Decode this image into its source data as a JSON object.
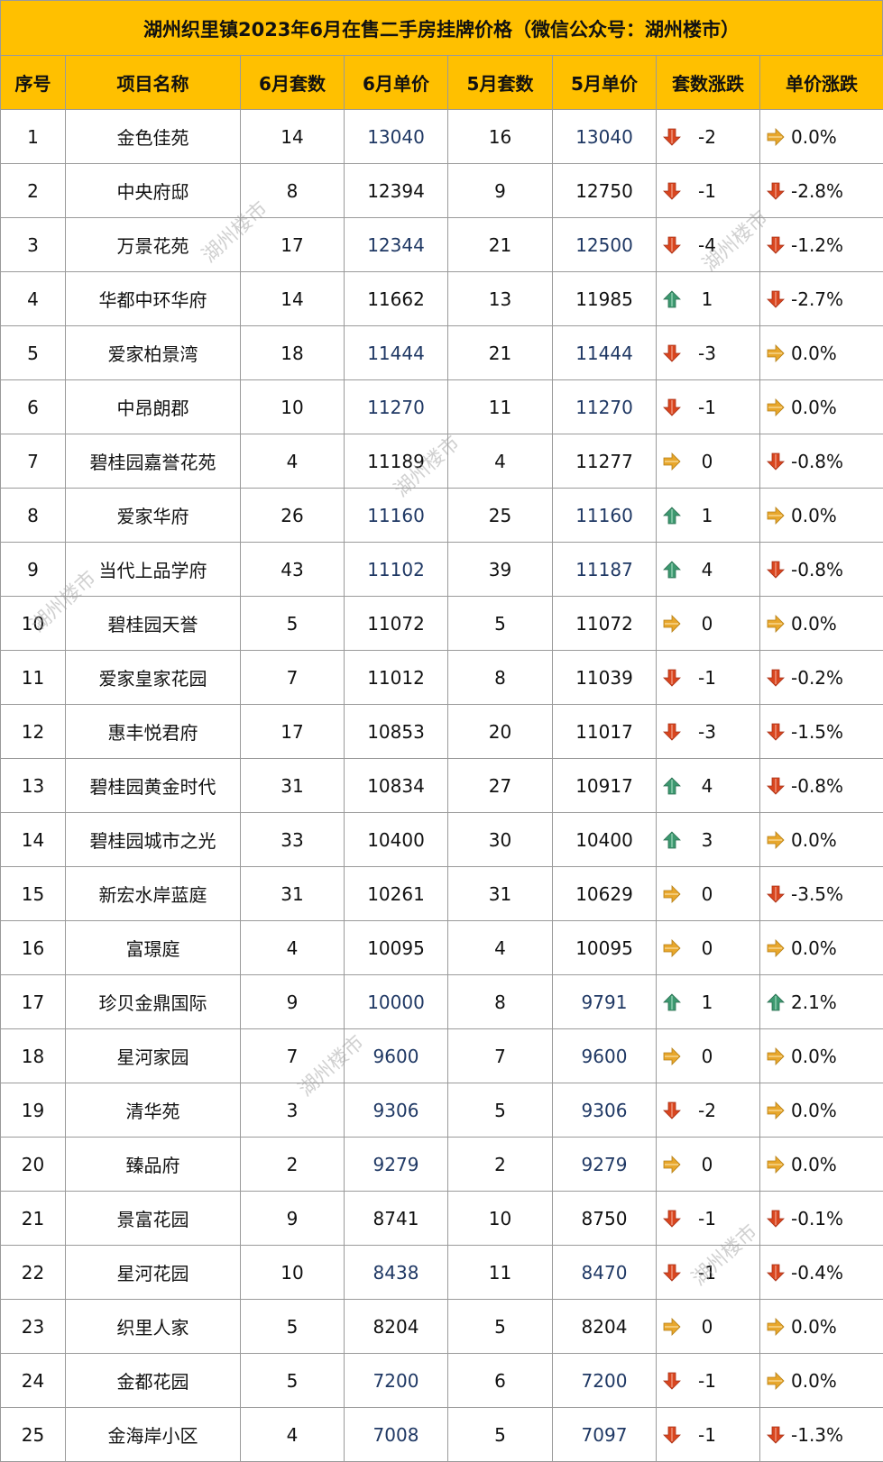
{
  "title": "湖州织里镇2023年6月在售二手房挂牌价格（微信公众号：湖州楼市）",
  "headers": [
    "序号",
    "项目名称",
    "6月套数",
    "6月单价",
    "5月套数",
    "5月单价",
    "套数涨跌",
    "单价涨跌"
  ],
  "watermark": "湖州楼市",
  "colors": {
    "header_bg": "#FFC000",
    "up": "#3d9970",
    "down": "#d9461f",
    "flat": "#e8a72c",
    "blue_price": "#1f3864"
  },
  "rows": [
    {
      "no": "1",
      "name": "金色佳苑",
      "jun_count": "14",
      "jun_price": "13040",
      "may_count": "16",
      "may_price": "13040",
      "count_dir": "down",
      "count_change": "-2",
      "price_dir": "flat",
      "price_change": "0.0%"
    },
    {
      "no": "2",
      "name": "中央府邸",
      "jun_count": "8",
      "jun_price": "12394",
      "may_count": "9",
      "may_price": "12750",
      "count_dir": "down",
      "count_change": "-1",
      "price_dir": "down",
      "price_change": "-2.8%"
    },
    {
      "no": "3",
      "name": "万景花苑",
      "jun_count": "17",
      "jun_price": "12344",
      "may_count": "21",
      "may_price": "12500",
      "count_dir": "down",
      "count_change": "-4",
      "price_dir": "down",
      "price_change": "-1.2%"
    },
    {
      "no": "4",
      "name": "华都中环华府",
      "jun_count": "14",
      "jun_price": "11662",
      "may_count": "13",
      "may_price": "11985",
      "count_dir": "up",
      "count_change": "1",
      "price_dir": "down",
      "price_change": "-2.7%"
    },
    {
      "no": "5",
      "name": "爱家柏景湾",
      "jun_count": "18",
      "jun_price": "11444",
      "may_count": "21",
      "may_price": "11444",
      "count_dir": "down",
      "count_change": "-3",
      "price_dir": "flat",
      "price_change": "0.0%"
    },
    {
      "no": "6",
      "name": "中昂朗郡",
      "jun_count": "10",
      "jun_price": "11270",
      "may_count": "11",
      "may_price": "11270",
      "count_dir": "down",
      "count_change": "-1",
      "price_dir": "flat",
      "price_change": "0.0%"
    },
    {
      "no": "7",
      "name": "碧桂园嘉誉花苑",
      "jun_count": "4",
      "jun_price": "11189",
      "may_count": "4",
      "may_price": "11277",
      "count_dir": "flat",
      "count_change": "0",
      "price_dir": "down",
      "price_change": "-0.8%"
    },
    {
      "no": "8",
      "name": "爱家华府",
      "jun_count": "26",
      "jun_price": "11160",
      "may_count": "25",
      "may_price": "11160",
      "count_dir": "up",
      "count_change": "1",
      "price_dir": "flat",
      "price_change": "0.0%"
    },
    {
      "no": "9",
      "name": "当代上品学府",
      "jun_count": "43",
      "jun_price": "11102",
      "may_count": "39",
      "may_price": "11187",
      "count_dir": "up",
      "count_change": "4",
      "price_dir": "down",
      "price_change": "-0.8%"
    },
    {
      "no": "10",
      "name": "碧桂园天誉",
      "jun_count": "5",
      "jun_price": "11072",
      "may_count": "5",
      "may_price": "11072",
      "count_dir": "flat",
      "count_change": "0",
      "price_dir": "flat",
      "price_change": "0.0%"
    },
    {
      "no": "11",
      "name": "爱家皇家花园",
      "jun_count": "7",
      "jun_price": "11012",
      "may_count": "8",
      "may_price": "11039",
      "count_dir": "down",
      "count_change": "-1",
      "price_dir": "down",
      "price_change": "-0.2%"
    },
    {
      "no": "12",
      "name": "惠丰悦君府",
      "jun_count": "17",
      "jun_price": "10853",
      "may_count": "20",
      "may_price": "11017",
      "count_dir": "down",
      "count_change": "-3",
      "price_dir": "down",
      "price_change": "-1.5%"
    },
    {
      "no": "13",
      "name": "碧桂园黄金时代",
      "jun_count": "31",
      "jun_price": "10834",
      "may_count": "27",
      "may_price": "10917",
      "count_dir": "up",
      "count_change": "4",
      "price_dir": "down",
      "price_change": "-0.8%"
    },
    {
      "no": "14",
      "name": "碧桂园城市之光",
      "jun_count": "33",
      "jun_price": "10400",
      "may_count": "30",
      "may_price": "10400",
      "count_dir": "up",
      "count_change": "3",
      "price_dir": "flat",
      "price_change": "0.0%"
    },
    {
      "no": "15",
      "name": "新宏水岸蓝庭",
      "jun_count": "31",
      "jun_price": "10261",
      "may_count": "31",
      "may_price": "10629",
      "count_dir": "flat",
      "count_change": "0",
      "price_dir": "down",
      "price_change": "-3.5%"
    },
    {
      "no": "16",
      "name": "富璟庭",
      "jun_count": "4",
      "jun_price": "10095",
      "may_count": "4",
      "may_price": "10095",
      "count_dir": "flat",
      "count_change": "0",
      "price_dir": "flat",
      "price_change": "0.0%"
    },
    {
      "no": "17",
      "name": "珍贝金鼎国际",
      "jun_count": "9",
      "jun_price": "10000",
      "may_count": "8",
      "may_price": "9791",
      "count_dir": "up",
      "count_change": "1",
      "price_dir": "up",
      "price_change": "2.1%"
    },
    {
      "no": "18",
      "name": "星河家园",
      "jun_count": "7",
      "jun_price": "9600",
      "may_count": "7",
      "may_price": "9600",
      "count_dir": "flat",
      "count_change": "0",
      "price_dir": "flat",
      "price_change": "0.0%"
    },
    {
      "no": "19",
      "name": "清华苑",
      "jun_count": "3",
      "jun_price": "9306",
      "may_count": "5",
      "may_price": "9306",
      "count_dir": "down",
      "count_change": "-2",
      "price_dir": "flat",
      "price_change": "0.0%"
    },
    {
      "no": "20",
      "name": "臻品府",
      "jun_count": "2",
      "jun_price": "9279",
      "may_count": "2",
      "may_price": "9279",
      "count_dir": "flat",
      "count_change": "0",
      "price_dir": "flat",
      "price_change": "0.0%"
    },
    {
      "no": "21",
      "name": "景富花园",
      "jun_count": "9",
      "jun_price": "8741",
      "may_count": "10",
      "may_price": "8750",
      "count_dir": "down",
      "count_change": "-1",
      "price_dir": "down",
      "price_change": "-0.1%"
    },
    {
      "no": "22",
      "name": "星河花园",
      "jun_count": "10",
      "jun_price": "8438",
      "may_count": "11",
      "may_price": "8470",
      "count_dir": "down",
      "count_change": "-1",
      "price_dir": "down",
      "price_change": "-0.4%"
    },
    {
      "no": "23",
      "name": "织里人家",
      "jun_count": "5",
      "jun_price": "8204",
      "may_count": "5",
      "may_price": "8204",
      "count_dir": "flat",
      "count_change": "0",
      "price_dir": "flat",
      "price_change": "0.0%"
    },
    {
      "no": "24",
      "name": "金都花园",
      "jun_count": "5",
      "jun_price": "7200",
      "may_count": "6",
      "may_price": "7200",
      "count_dir": "down",
      "count_change": "-1",
      "price_dir": "flat",
      "price_change": "0.0%"
    },
    {
      "no": "25",
      "name": "金海岸小区",
      "jun_count": "4",
      "jun_price": "7008",
      "may_count": "5",
      "may_price": "7097",
      "count_dir": "down",
      "count_change": "-1",
      "price_dir": "down",
      "price_change": "-1.3%"
    }
  ],
  "blue_price_rows": [
    1,
    3,
    5,
    6,
    8,
    9,
    17,
    18,
    19,
    20,
    22,
    24,
    25
  ]
}
